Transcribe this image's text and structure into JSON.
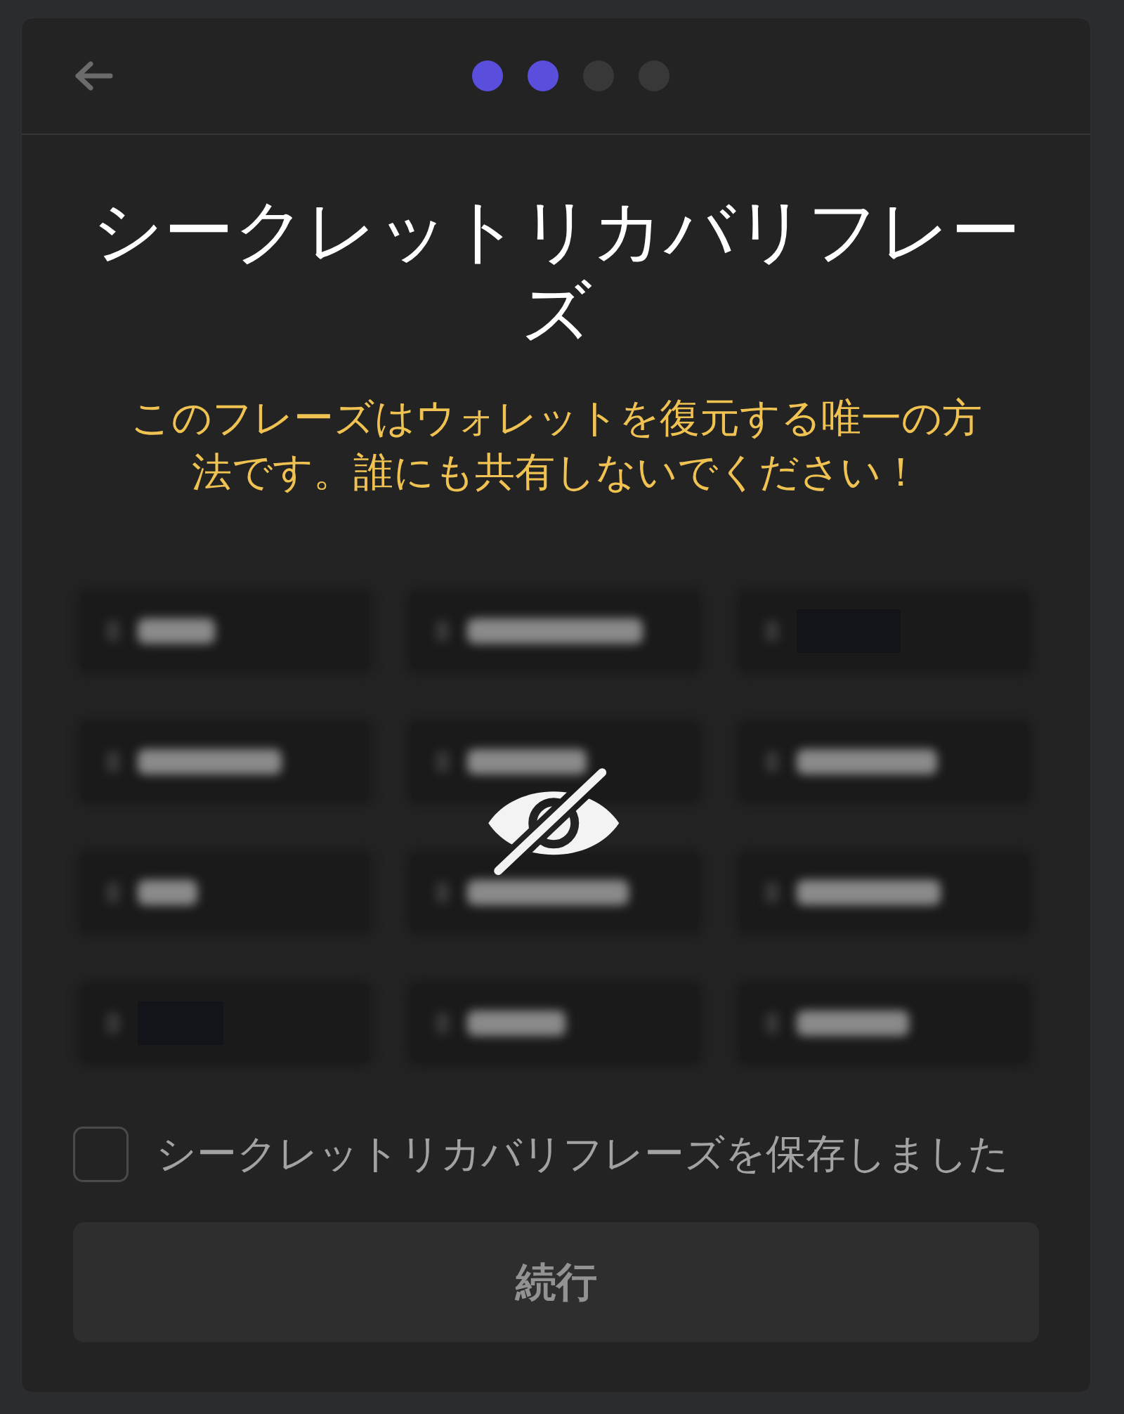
{
  "header": {
    "steps": [
      {
        "completed": true
      },
      {
        "completed": true
      },
      {
        "completed": false
      },
      {
        "completed": false
      }
    ]
  },
  "title": "シークレットリカバリフレーズ",
  "warning": "このフレーズはウォレットを復元する唯一の方法です。誰にも共有しないでください！",
  "phrase_grid": {
    "hidden": true,
    "words": [
      {
        "redacted": false
      },
      {
        "redacted": false
      },
      {
        "redacted": true
      },
      {
        "redacted": false
      },
      {
        "redacted": false
      },
      {
        "redacted": false
      },
      {
        "redacted": false
      },
      {
        "redacted": false
      },
      {
        "redacted": false
      },
      {
        "redacted": true
      },
      {
        "redacted": false
      },
      {
        "redacted": false
      }
    ]
  },
  "confirm_checkbox": {
    "label": "シークレットリカバリフレーズを保存しました",
    "checked": false
  },
  "continue_button": {
    "label": "続行",
    "disabled": true
  }
}
